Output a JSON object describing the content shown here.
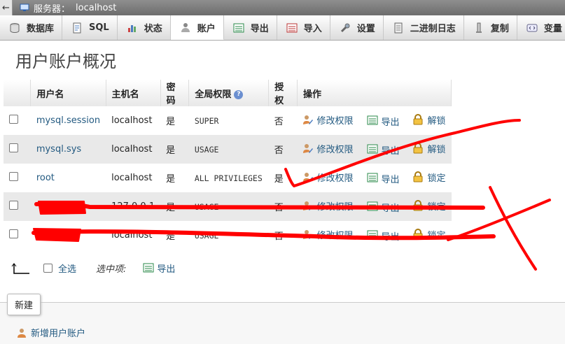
{
  "topbar": {
    "server_label": "服务器：",
    "server_name": "localhost"
  },
  "tabs": [
    {
      "label": "数据库",
      "icon": "database-icon"
    },
    {
      "label": "SQL",
      "icon": "sql-icon"
    },
    {
      "label": "状态",
      "icon": "status-chart-icon"
    },
    {
      "label": "账户",
      "icon": "accounts-icon"
    },
    {
      "label": "导出",
      "icon": "export-icon"
    },
    {
      "label": "导入",
      "icon": "import-icon"
    },
    {
      "label": "设置",
      "icon": "wrench-icon"
    },
    {
      "label": "二进制日志",
      "icon": "binlog-icon"
    },
    {
      "label": "复制",
      "icon": "replication-icon"
    },
    {
      "label": "变量",
      "icon": "variables-icon"
    }
  ],
  "active_tab": "账户",
  "page_title": "用户账户概况",
  "table": {
    "headers": {
      "username": "用户名",
      "host": "主机名",
      "password": "密码",
      "privileges": "全局权限",
      "grant": "授权",
      "actions": "操作"
    },
    "rows": [
      {
        "user": "mysql.session",
        "host": "localhost",
        "password": "是",
        "privileges": "SUPER",
        "grant": "否",
        "edit": "修改权限",
        "export": "导出",
        "lock": "解锁"
      },
      {
        "user": "mysql.sys",
        "host": "localhost",
        "password": "是",
        "privileges": "USAGE",
        "grant": "否",
        "edit": "修改权限",
        "export": "导出",
        "lock": "解锁"
      },
      {
        "user": "root",
        "host": "localhost",
        "password": "是",
        "privileges": "ALL PRIVILEGES",
        "grant": "是",
        "edit": "修改权限",
        "export": "导出",
        "lock": "锁定"
      },
      {
        "user": "",
        "host": "127.0.0.1",
        "password": "是",
        "privileges": "USAGE",
        "grant": "否",
        "edit": "修改权限",
        "export": "导出",
        "lock": "锁定"
      },
      {
        "user": "",
        "host": "localhost",
        "password": "是",
        "privileges": "USAGE",
        "grant": "否",
        "edit": "修改权限",
        "export": "导出",
        "lock": "锁定"
      }
    ]
  },
  "bulk": {
    "select_all": "全选",
    "with_selected": "选中项:",
    "export": "导出"
  },
  "new_section": {
    "legend": "新建",
    "add_user": "新增用户账户"
  },
  "colors": {
    "link": "#235a81",
    "scribble": "#ff0000"
  }
}
